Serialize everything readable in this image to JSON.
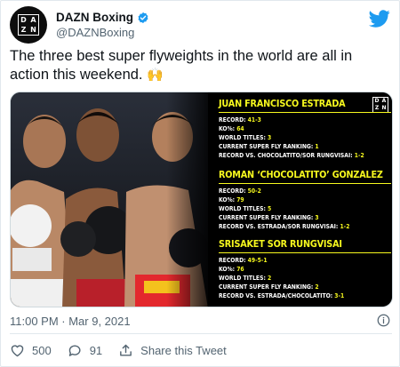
{
  "account": {
    "display_name": "DAZN Boxing",
    "handle": "@DAZNBoxing",
    "avatar_letters": [
      "D",
      "A",
      "Z",
      "N"
    ]
  },
  "tweet": {
    "text": "The three best super flyweights in the world are all in action this weekend.",
    "emoji": "🙌",
    "timestamp": "11:00 PM · Mar 9, 2021"
  },
  "media": {
    "logo_letters": [
      "D",
      "A",
      "Z",
      "N"
    ],
    "fighters": [
      {
        "name": "JUAN FRANCISCO ESTRADA",
        "stats": [
          {
            "label": "RECORD:",
            "value": "41-3"
          },
          {
            "label": "KO%:",
            "value": "64"
          },
          {
            "label": "WORLD TITLES:",
            "value": "3"
          },
          {
            "label": "CURRENT SUPER FLY RANKING:",
            "value": "1"
          },
          {
            "label": "RECORD VS. CHOCOLATITO/SOR RUNGVISAI:",
            "value": "1-2"
          }
        ]
      },
      {
        "name": "ROMAN ‘CHOCOLATITO’ GONZALEZ",
        "stats": [
          {
            "label": "RECORD:",
            "value": "50-2"
          },
          {
            "label": "KO%:",
            "value": "79"
          },
          {
            "label": "WORLD TITLES:",
            "value": "5"
          },
          {
            "label": "CURRENT SUPER FLY RANKING:",
            "value": "3"
          },
          {
            "label": "RECORD VS. ESTRADA/SOR RUNGVISAI:",
            "value": "1-2"
          }
        ]
      },
      {
        "name": "SRISAKET SOR RUNGVISAI",
        "stats": [
          {
            "label": "RECORD:",
            "value": "49-5-1"
          },
          {
            "label": "KO%:",
            "value": "76"
          },
          {
            "label": "WORLD TITLES:",
            "value": "2"
          },
          {
            "label": "CURRENT SUPER FLY RANKING:",
            "value": "2"
          },
          {
            "label": "RECORD VS. ESTRADA/CHOCOLATITO:",
            "value": "3-1"
          }
        ]
      }
    ]
  },
  "actions": {
    "likes": "500",
    "replies": "91",
    "share_label": "Share this Tweet"
  },
  "colors": {
    "twitter_blue": "#1d9bf0",
    "stat_yellow": "#f7f91e",
    "like_red": "#e0245e"
  },
  "icons": [
    "verified-badge-icon",
    "twitter-bird-icon",
    "info-icon",
    "heart-icon",
    "reply-icon",
    "share-icon"
  ]
}
